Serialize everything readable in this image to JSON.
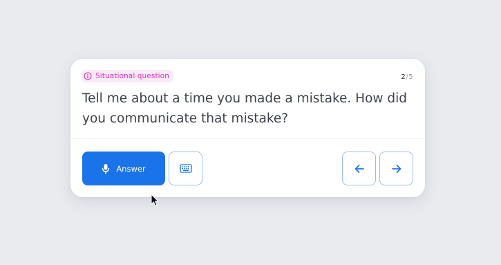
{
  "card": {
    "badge_label": "Situational question",
    "counter_current": "2",
    "counter_total": "/5",
    "question": "Tell me about a time you made a mistake. How did you communicate that mistake?"
  },
  "actions": {
    "answer_label": "Answer",
    "answer_icon": "microphone-icon",
    "keyboard_icon": "keyboard-icon",
    "prev_icon": "arrow-left-icon",
    "next_icon": "arrow-right-icon"
  },
  "colors": {
    "background": "#e9ebef",
    "accent": "#1a73e8",
    "badge_text": "#d533b6",
    "badge_bg": "#fbeaf7",
    "outline": "#9bbcf2"
  }
}
